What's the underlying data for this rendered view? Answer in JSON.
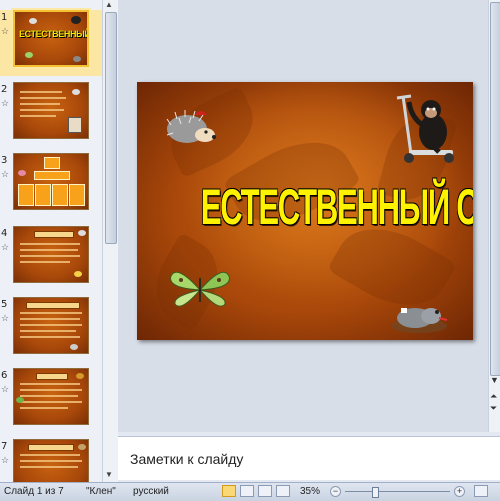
{
  "thumbnails": [
    {
      "number": "1",
      "title": "ЕСТЕСТВЕННЫЙ ОТБОР",
      "selected": true
    },
    {
      "number": "2"
    },
    {
      "number": "3"
    },
    {
      "number": "4"
    },
    {
      "number": "5"
    },
    {
      "number": "6"
    },
    {
      "number": "7"
    }
  ],
  "slide": {
    "title": "ЕСТЕСТВЕННЫЙ ОТБОР",
    "clipart": [
      "hedgehog",
      "monkey-on-scooter",
      "butterfly",
      "mole"
    ]
  },
  "notes": {
    "placeholder": "Заметки к слайду"
  },
  "status": {
    "slide_info": "Слайд 1 из 7",
    "theme": "\"Клен\"",
    "language": "русский",
    "zoom": "35%"
  },
  "colors": {
    "slide_background": "#b4520c",
    "title_fill": "#fff200",
    "selected_thumb": "#f5c132"
  }
}
